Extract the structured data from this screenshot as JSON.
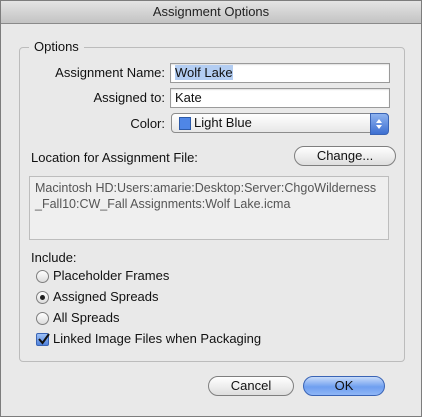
{
  "window": {
    "title": "Assignment Options"
  },
  "options": {
    "legend": "Options",
    "assignment_name_label": "Assignment Name:",
    "assignment_name_value": "Wolf Lake",
    "assigned_to_label": "Assigned to:",
    "assigned_to_value": "Kate",
    "color_label": "Color:",
    "color_value": "Light Blue",
    "color_swatch": "#4f86e6",
    "location_label": "Location for Assignment File:",
    "change_button": "Change...",
    "file_path": "Macintosh HD:Users:amarie:Desktop:Server:ChgoWilderness_Fall10:CW_Fall Assignments:Wolf Lake.icma"
  },
  "include": {
    "label": "Include:",
    "options": [
      {
        "label": "Placeholder Frames",
        "selected": false
      },
      {
        "label": "Assigned Spreads",
        "selected": true
      },
      {
        "label": "All Spreads",
        "selected": false
      }
    ],
    "linked_images_label": "Linked Image Files when Packaging",
    "linked_images_checked": true
  },
  "buttons": {
    "cancel": "Cancel",
    "ok": "OK"
  },
  "colors": {
    "accent": "#3d6fd1",
    "selection": "#b3cdf2"
  }
}
